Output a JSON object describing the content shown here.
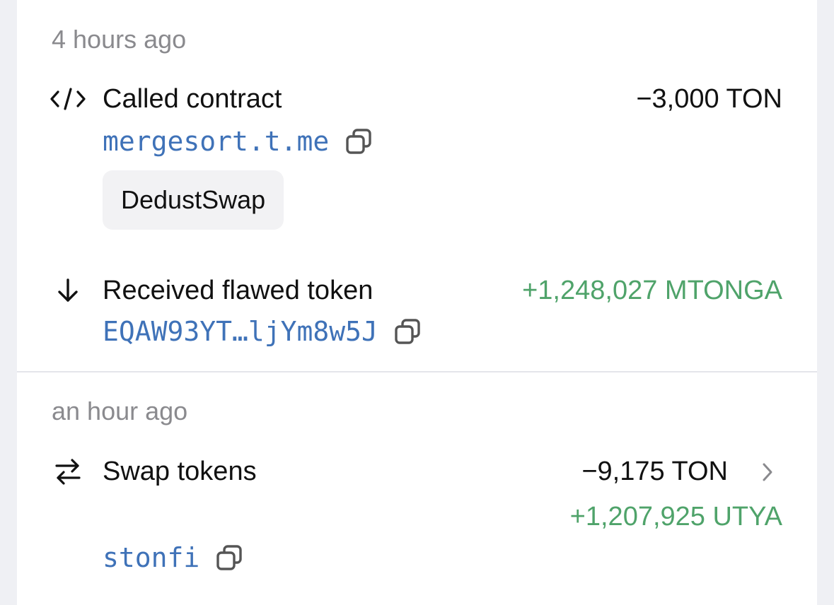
{
  "groups": [
    {
      "timestamp": "4 hours ago",
      "events": [
        {
          "icon": "code-icon",
          "title": "Called contract",
          "amount": "−3,000 TON",
          "address": "mergesort.t.me",
          "tag": "DedustSwap"
        },
        {
          "icon": "arrow-down-icon",
          "title": "Received flawed token",
          "amount": "+1,248,027 MTONGA",
          "address": "EQAW93YT…ljYm8w5J"
        }
      ]
    },
    {
      "timestamp": "an hour ago",
      "events": [
        {
          "icon": "swap-arrows-icon",
          "title": "Swap tokens",
          "amount_out": "−9,175 TON",
          "amount_in": "+1,207,925 UTYA",
          "address": "stonfi"
        }
      ]
    }
  ],
  "colors": {
    "positive": "#4fa36a",
    "link": "#3f72b8",
    "muted": "#8a8a8e"
  }
}
